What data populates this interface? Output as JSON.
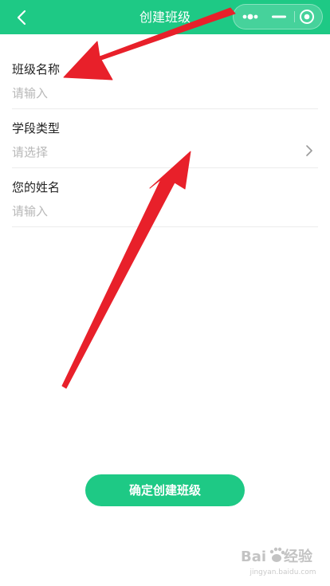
{
  "header": {
    "title": "创建班级",
    "bg_color": "#1ec985"
  },
  "form": {
    "class_name": {
      "label": "班级名称",
      "placeholder": "请输入"
    },
    "stage_type": {
      "label": "学段类型",
      "placeholder": "请选择"
    },
    "your_name": {
      "label": "您的姓名",
      "placeholder": "请输入"
    }
  },
  "submit": {
    "label": "确定创建班级"
  },
  "annotations": {
    "arrow_color": "#e8202a"
  },
  "watermark": {
    "brand": "Baidu经验",
    "url": "jingyan.baidu.com"
  },
  "icons": {
    "back": "chevron-left-icon",
    "more": "more-dots-icon",
    "minimize": "minimize-icon",
    "close": "target-close-icon",
    "select": "chevron-right-icon"
  }
}
